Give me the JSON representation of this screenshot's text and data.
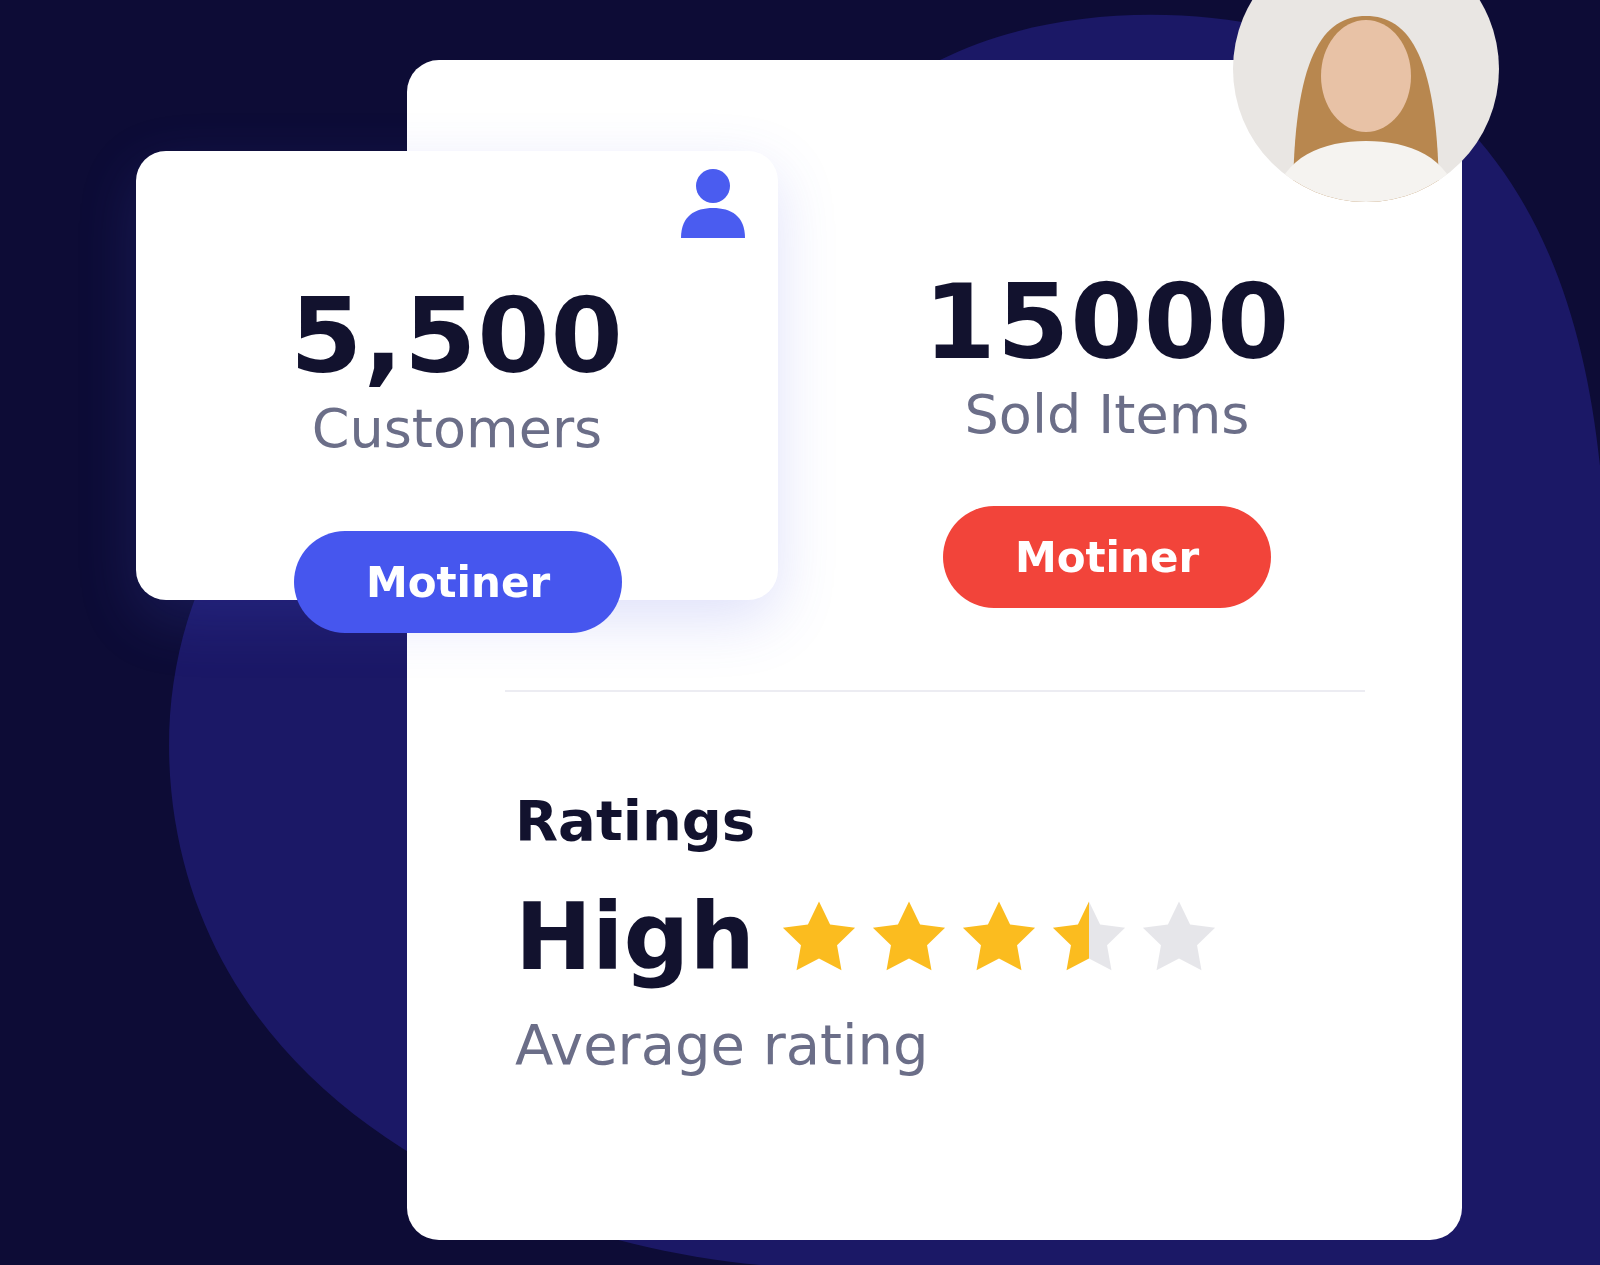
{
  "customers_card": {
    "value": "5,500",
    "label": "Customers",
    "button": "Motiner"
  },
  "sold_card": {
    "value": "15000",
    "label": "Sold Items",
    "button": "Motiner"
  },
  "ratings": {
    "title": "Ratings",
    "level": "High",
    "stars": 3.5,
    "caption": "Average rating"
  }
}
